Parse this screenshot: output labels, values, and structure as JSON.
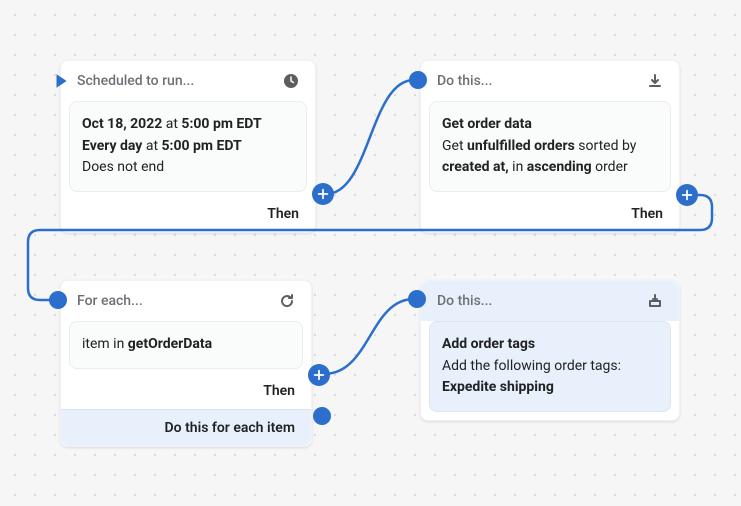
{
  "card1": {
    "header": "Scheduled to run...",
    "date_prefix": "Oct 18, 2022",
    "at1": " at ",
    "time1": "5:00 pm EDT",
    "every": "Every day",
    "at2": " at ",
    "time2": "5:00 pm EDT",
    "no_end": "Does not end",
    "then": "Then"
  },
  "card2": {
    "header": "Do this...",
    "title": "Get order data",
    "l1a": "Get ",
    "l1b": "unfulfilled orders",
    "l1c": " sorted by",
    "l2a": "created at,",
    "l2b": " in ",
    "l2c": "ascending",
    "l2d": " order",
    "then": "Then"
  },
  "card3": {
    "header": "For each...",
    "body_a": "item in ",
    "body_b": "getOrderData",
    "then": "Then",
    "footer": "Do this for each item"
  },
  "card4": {
    "header": "Do this...",
    "title": "Add order tags",
    "line1": "Add the following order tags:",
    "line2": "Expedite shipping"
  }
}
